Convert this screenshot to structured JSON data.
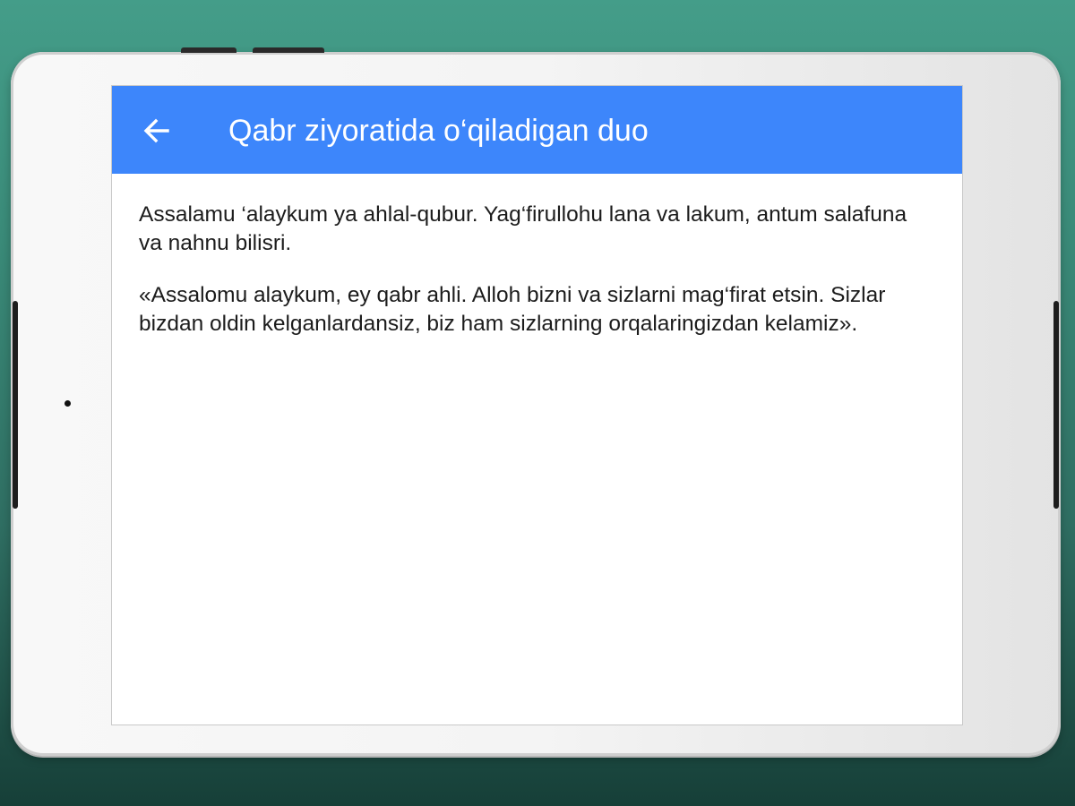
{
  "app_bar": {
    "title": "Qabr ziyoratida o‘qiladigan duo",
    "back_icon": "arrow-left-icon",
    "color": "#3d86fb"
  },
  "content": {
    "paragraphs": [
      "Assalamu ‘alaykum ya ahlal-qubur. Yag‘firullohu lana va lakum, antum salafuna va nahnu bilisri.",
      "«Assalomu alaykum, ey qabr ahli. Alloh bizni va sizlarni mag‘firat etsin. Sizlar bizdan oldin kelganlardansiz, biz ham sizlarning orqalaringizdan kelamiz»."
    ]
  }
}
